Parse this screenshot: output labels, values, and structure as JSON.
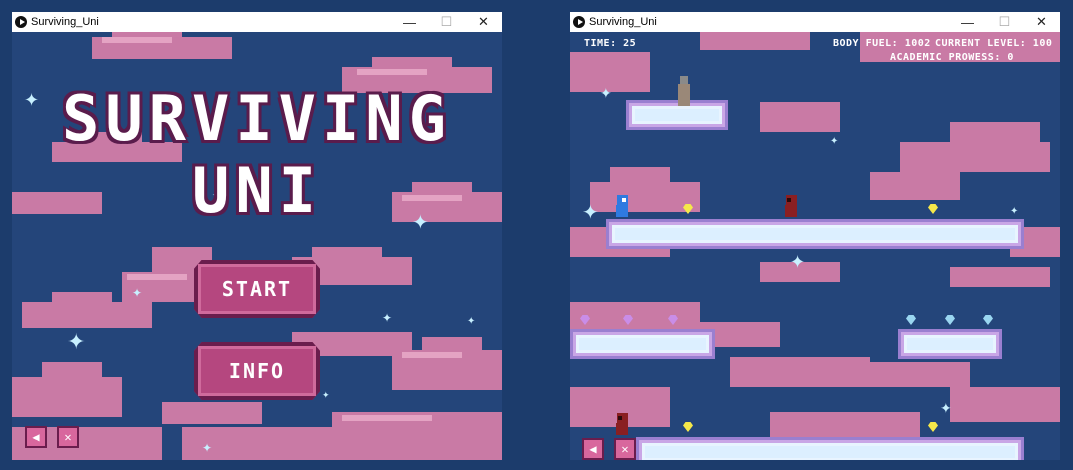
{
  "left_window": {
    "title": "Surviving_Uni",
    "controls": {
      "minimize": "—",
      "maximize": "☐",
      "close": "✕"
    },
    "game_title_line1": "SURVIVING",
    "game_title_line2": "UNI",
    "start_label": "START",
    "info_label": "INFO",
    "sound_on_icon": "speaker-on-icon",
    "sound_off_icon": "speaker-mute-icon"
  },
  "right_window": {
    "title": "Surviving_Uni",
    "controls": {
      "minimize": "—",
      "maximize": "☐",
      "close": "✕"
    },
    "hud": {
      "time": "TIME: 25",
      "body_fuel": "BODY FUEL: 1002",
      "current_level": "CURRENT LEVEL: 100",
      "academic_prowess": "ACADEMIC PROWESS: 0"
    },
    "sound_on_icon": "speaker-on-icon",
    "sound_off_icon": "speaker-mute-icon"
  },
  "colors": {
    "sky": "#24457a",
    "cloud": "#c97aa5",
    "button": "#b5477f",
    "gem_yellow": "#f5e84a",
    "gem_purple": "#c98de8",
    "gem_blue": "#9ad6f0",
    "player": "#2f7ae0",
    "enemy": "#8a1f22"
  }
}
